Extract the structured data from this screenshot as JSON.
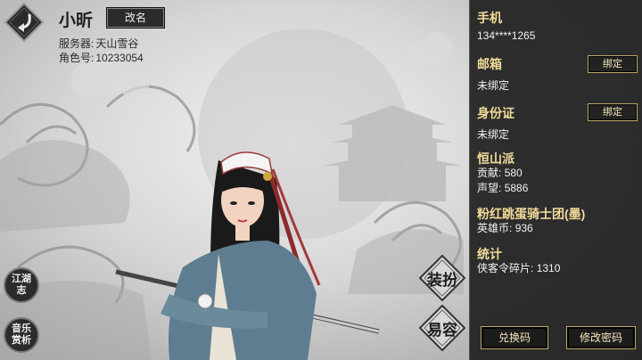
{
  "player": {
    "name": "小昕",
    "rename_label": "改名",
    "server_label": "服务器:",
    "server_value": "天山雪谷",
    "role_id_label": "角色号:",
    "role_id_value": "10233054"
  },
  "side_buttons": {
    "jianghu": "江湖志",
    "music": "音乐赏析"
  },
  "actions": {
    "dress": "装扮",
    "appearance": "易容"
  },
  "panel": {
    "phone_title": "手机",
    "phone_value": "134****1265",
    "email_title": "邮箱",
    "email_value": "未绑定",
    "email_bind": "绑定",
    "id_title": "身份证",
    "id_value": "未绑定",
    "id_bind": "绑定",
    "sect_title": "恒山派",
    "contribution_label": "贡献:",
    "contribution_value": "580",
    "fame_label": "声望:",
    "fame_value": "5886",
    "guild_title": "粉红跳蛋骑士团(墨)",
    "hero_coin_label": "英雄币:",
    "hero_coin_value": "936",
    "stats_title": "统计",
    "token_label": "侠客令碎片:",
    "token_value": "1310",
    "redeem_button": "兑换码",
    "change_password_button": "修改密码"
  },
  "colors": {
    "panel_bg": "#202020",
    "gold_text": "#f2dc9a",
    "button_border": "#bda868"
  }
}
